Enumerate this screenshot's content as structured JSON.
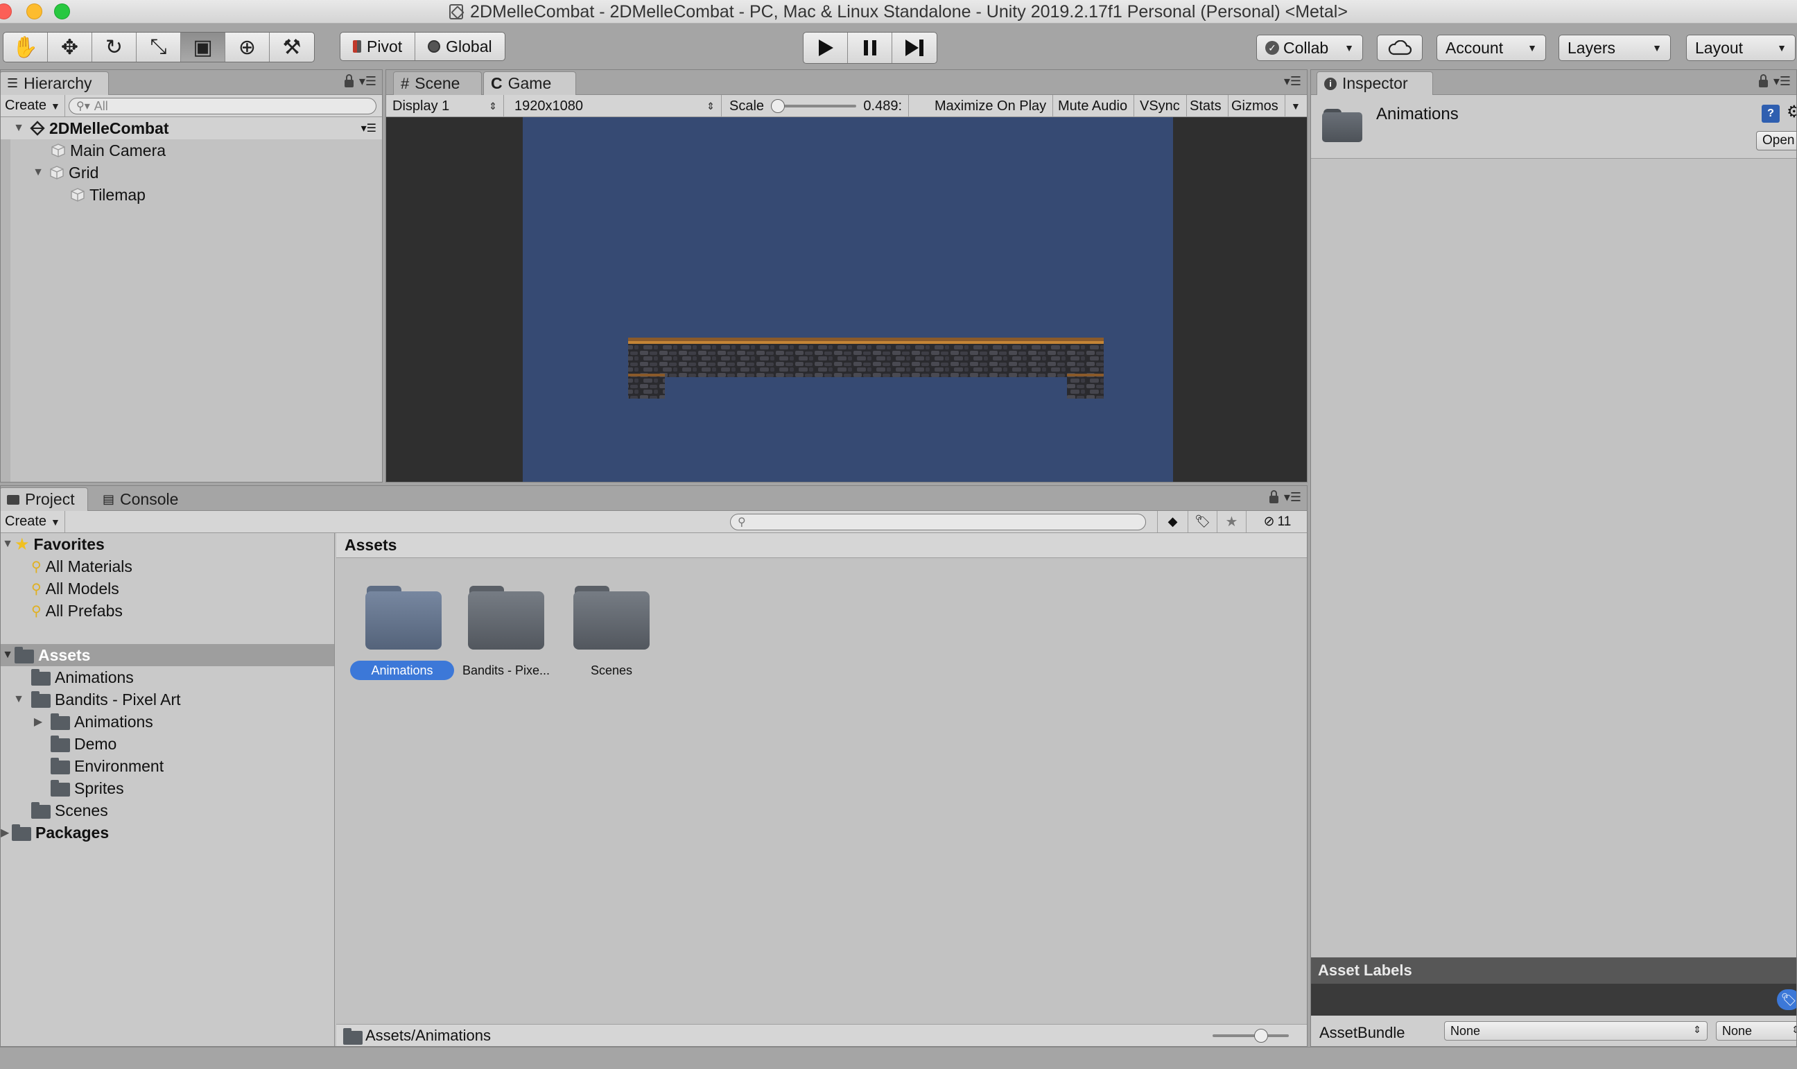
{
  "window": {
    "title": "2DMelleCombat - 2DMelleCombat - PC, Mac & Linux Standalone - Unity 2019.2.17f1 Personal (Personal) <Metal>"
  },
  "toolbar": {
    "tools": [
      {
        "name": "hand-tool-icon",
        "glyph": "✋"
      },
      {
        "name": "move-tool-icon",
        "glyph": "✥"
      },
      {
        "name": "rotate-tool-icon",
        "glyph": "↻"
      },
      {
        "name": "scale-tool-icon",
        "glyph": "⤡"
      },
      {
        "name": "rect-tool-icon",
        "glyph": "▣"
      },
      {
        "name": "transform-tool-icon",
        "glyph": "⊕"
      },
      {
        "name": "custom-tool-icon",
        "glyph": "⚒"
      }
    ],
    "pivot": "Pivot",
    "global": "Global",
    "collab": "Collab",
    "account": "Account",
    "layers": "Layers",
    "layout": "Layout"
  },
  "hierarchy": {
    "tab": "Hierarchy",
    "create": "Create",
    "search_placeholder": "All",
    "items": [
      {
        "label": "2DMelleCombat",
        "level": 0,
        "expanded": true,
        "bold": true
      },
      {
        "label": "Main Camera",
        "level": 1
      },
      {
        "label": "Grid",
        "level": 1,
        "expanded": true
      },
      {
        "label": "Tilemap",
        "level": 2
      }
    ]
  },
  "scene_tabs": {
    "scene": "Scene",
    "game": "Game"
  },
  "game_toolbar": {
    "display": "Display 1",
    "resolution": "1920x1080",
    "scale_label": "Scale",
    "scale_value": "0.489:",
    "maximize": "Maximize On Play",
    "mute": "Mute Audio",
    "vsync": "VSync",
    "stats": "Stats",
    "gizmos": "Gizmos"
  },
  "inspector": {
    "tab": "Inspector",
    "asset_name": "Animations",
    "open_button": "Open",
    "asset_labels": "Asset Labels",
    "assetbundle_label": "AssetBundle",
    "assetbundle_value": "None",
    "variant_value": "None"
  },
  "project": {
    "tab_project": "Project",
    "tab_console": "Console",
    "create": "Create",
    "hidden_count": "11",
    "favorites": "Favorites",
    "favorite_items": [
      "All Materials",
      "All Models",
      "All Prefabs"
    ],
    "assets_root": "Assets",
    "tree": [
      {
        "label": "Animations",
        "level": 1
      },
      {
        "label": "Bandits - Pixel Art",
        "level": 1,
        "expanded": true
      },
      {
        "label": "Animations",
        "level": 2,
        "collapsed": true
      },
      {
        "label": "Demo",
        "level": 2
      },
      {
        "label": "Environment",
        "level": 2
      },
      {
        "label": "Sprites",
        "level": 2
      },
      {
        "label": "Scenes",
        "level": 1
      }
    ],
    "packages": "Packages",
    "breadcrumb": "Assets",
    "grid_items": [
      {
        "label": "Animations",
        "selected": true
      },
      {
        "label": "Bandits - Pixe...",
        "selected": false
      },
      {
        "label": "Scenes",
        "selected": false
      }
    ],
    "footer_path": "Assets/Animations"
  },
  "colors": {
    "selection": "#3c78d8",
    "game_background": "#364a73",
    "editor_gray": "#c2c2c2"
  }
}
